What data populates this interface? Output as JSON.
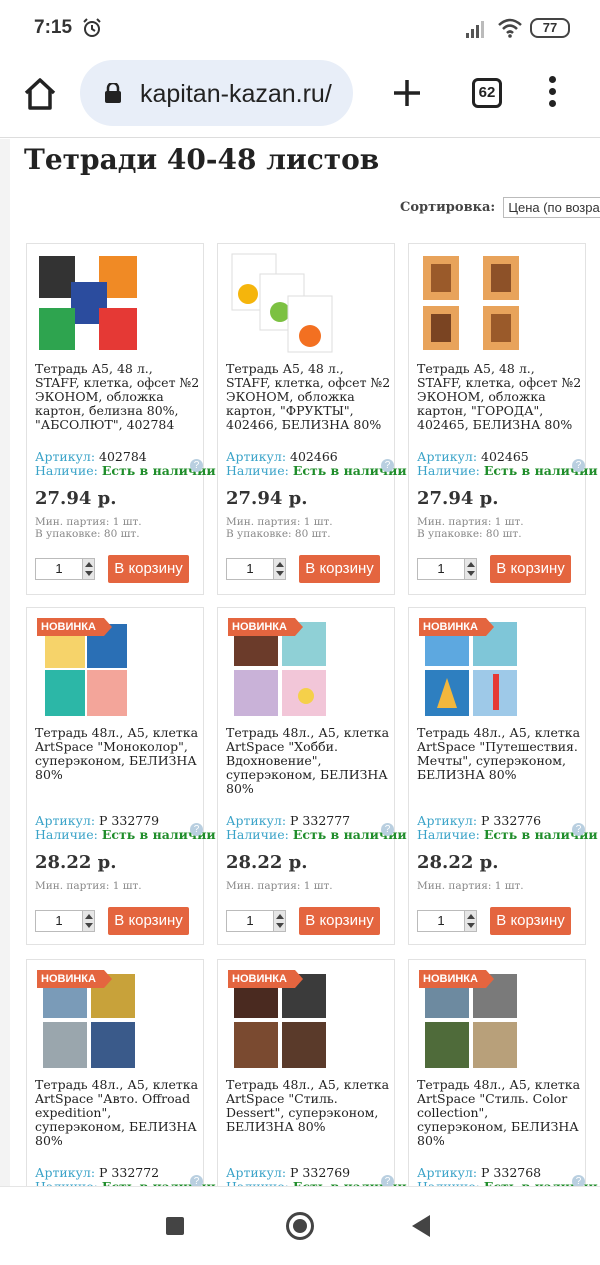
{
  "status": {
    "time": "7:15",
    "battery": "77"
  },
  "browser": {
    "url": "kapitan-kazan.ru/",
    "tab_count": "62"
  },
  "page": {
    "title": "Тетради 40-48 листов",
    "sort_label": "Сортировка:",
    "sort_value": "Цена (по возрастанию)"
  },
  "labels": {
    "sku": "Артикул:",
    "availability": "Наличие:",
    "in_stock": "Есть в наличии",
    "help": "?",
    "add_to_cart": "В корзину",
    "new_badge": "НОВИНКА"
  },
  "products": [
    {
      "title": "Тетрадь А5, 48 л., STAFF, клетка, офсет №2 ЭКОНОМ, обложка картон, белизна 80%, \"АБСОЛЮТ\", 402784",
      "sku": "402784",
      "price": "27.94 р.",
      "min_batch": "Мин. партия: 1 шт.",
      "pack": "В упаковке: 80 шт.",
      "qty": "1",
      "is_new": false
    },
    {
      "title": "Тетрадь А5, 48 л., STAFF, клетка, офсет №2 ЭКОНОМ, обложка картон, \"ФРУКТЫ\", 402466, БЕЛИЗНА 80%",
      "sku": "402466",
      "price": "27.94 р.",
      "min_batch": "Мин. партия: 1 шт.",
      "pack": "В упаковке: 80 шт.",
      "qty": "1",
      "is_new": false
    },
    {
      "title": "Тетрадь А5, 48 л., STAFF, клетка, офсет №2 ЭКОНОМ, обложка картон, \"ГОРОДА\", 402465, БЕЛИЗНА 80%",
      "sku": "402465",
      "price": "27.94 р.",
      "min_batch": "Мин. партия: 1 шт.",
      "pack": "В упаковке: 80 шт.",
      "qty": "1",
      "is_new": false
    },
    {
      "title": "Тетрадь 48л., А5, клетка ArtSpace \"Моноколор\", суперэконом, БЕЛИЗНА 80%",
      "sku": "P 332779",
      "price": "28.22 р.",
      "min_batch": "Мин. партия: 1 шт.",
      "pack": "",
      "qty": "1",
      "is_new": true
    },
    {
      "title": "Тетрадь 48л., А5, клетка ArtSpace \"Хобби. Вдохновение\", суперэконом, БЕЛИЗНА 80%",
      "sku": "P 332777",
      "price": "28.22 р.",
      "min_batch": "Мин. партия: 1 шт.",
      "pack": "",
      "qty": "1",
      "is_new": true
    },
    {
      "title": "Тетрадь 48л., А5, клетка ArtSpace \"Путешествия. Мечты\", суперэконом, БЕЛИЗНА 80%",
      "sku": "P 332776",
      "price": "28.22 р.",
      "min_batch": "Мин. партия: 1 шт.",
      "pack": "",
      "qty": "1",
      "is_new": true
    },
    {
      "title": "Тетрадь 48л., А5, клетка ArtSpace \"Авто. Offroad expedition\", суперэконом, БЕЛИЗНА 80%",
      "sku": "P 332772",
      "price": "",
      "min_batch": "",
      "pack": "",
      "qty": "",
      "is_new": true
    },
    {
      "title": "Тетрадь 48л., А5, клетка ArtSpace \"Стиль. Dessert\", суперэконом, БЕЛИЗНА 80%",
      "sku": "P 332769",
      "price": "",
      "min_batch": "",
      "pack": "",
      "qty": "",
      "is_new": true
    },
    {
      "title": "Тетрадь 48л., А5, клетка ArtSpace \"Стиль. Color collection\", суперэконом, БЕЛИЗНА 80%",
      "sku": "P 332768",
      "price": "",
      "min_batch": "",
      "pack": "",
      "qty": "",
      "is_new": true
    }
  ]
}
